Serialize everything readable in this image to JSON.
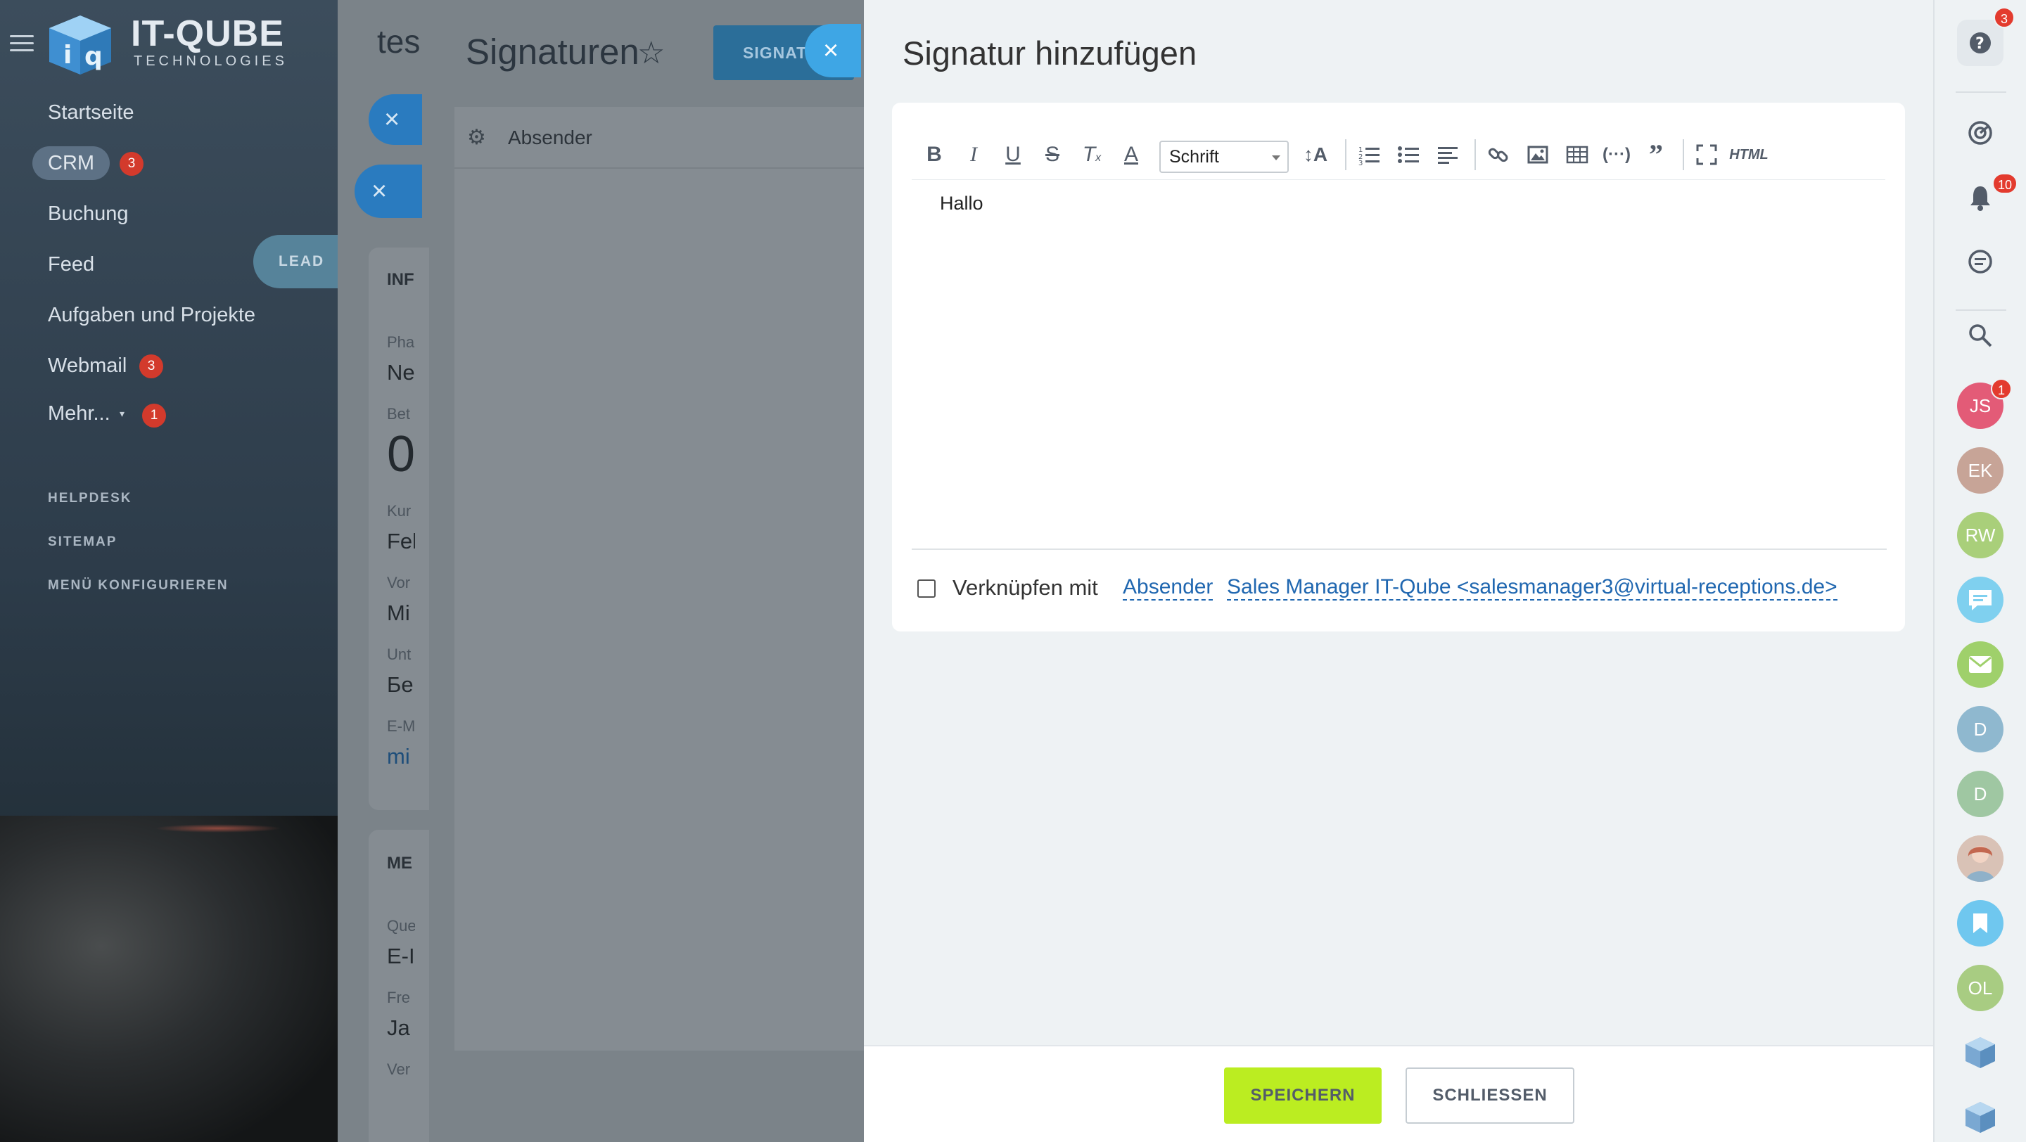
{
  "app": {
    "logo_title": "IT-QUBE",
    "logo_subtitle": "TECHNOLOGIES"
  },
  "left_menu": {
    "items": [
      {
        "label": "Startseite"
      },
      {
        "label": "CRM",
        "badge": "3"
      },
      {
        "label": "Buchung"
      },
      {
        "label": "Feed"
      },
      {
        "label": "Aufgaben und Projekte"
      },
      {
        "label": "Webmail",
        "badge": "3"
      },
      {
        "label": "Mehr...",
        "badge": "1"
      }
    ],
    "sub_items": [
      {
        "label": "HELPDESK"
      },
      {
        "label": "SITEMAP"
      },
      {
        "label": "MENÜ KONFIGURIEREN"
      }
    ],
    "lead_label": "LEAD"
  },
  "crm_behind": {
    "title": "tes",
    "card_section": "INF",
    "fields": [
      {
        "label": "Pha",
        "value": "Ne"
      },
      {
        "label": "Bet",
        "value": "0"
      },
      {
        "label": "Kur",
        "value": "Fel"
      },
      {
        "label": "Vor",
        "value": "Mi"
      },
      {
        "label": "Unt",
        "value": "Бе"
      },
      {
        "label": "E-M",
        "value": "mi"
      }
    ],
    "card2_section": "ME",
    "fields2": [
      {
        "label": "Que",
        "value": "E-I"
      },
      {
        "label": "Fre",
        "value": "Ja"
      },
      {
        "label": "Ver",
        "value": ""
      }
    ]
  },
  "signatures_panel": {
    "title": "Signaturen",
    "button_label": "SIGNATUR",
    "filter_label": "Absender"
  },
  "slider": {
    "title": "Signatur hinzufügen",
    "toolbar": {
      "font_select_value": "Schrift",
      "html_label": "HTML"
    },
    "editor_content": "Hallo",
    "link": {
      "label": "Verknüpfen mit",
      "sender_link": "Absender",
      "sender_value": "Sales Manager IT-Qube <salesmanager3@virtual-receptions.de>",
      "checked": false
    },
    "footer": {
      "save_label": "SPEICHERN",
      "close_label": "SCHLIESSEN"
    }
  },
  "right_bar": {
    "help_badge": "3",
    "notifications_badge": "10",
    "contacts": [
      {
        "initials": "JS",
        "color": "#e35b77",
        "badge": "1"
      },
      {
        "initials": "EK",
        "color": "#c7a497"
      },
      {
        "initials": "RW",
        "color": "#a9cf7a"
      },
      {
        "initials": "",
        "color": "#7fd0ef",
        "icon": "chat-bubble-icon"
      },
      {
        "initials": "",
        "color": "#9fd06b",
        "icon": "mail-icon"
      },
      {
        "initials": "D",
        "color": "#8fb8cf"
      },
      {
        "initials": "D",
        "color": "#9fc7a2"
      },
      {
        "initials": "",
        "color": "#d7b6a6",
        "icon": "user-photo"
      },
      {
        "initials": "",
        "color": "#6fc7ef",
        "icon": "bookmark-icon"
      },
      {
        "initials": "OL",
        "color": "#a8cc82"
      }
    ]
  },
  "colors": {
    "accent_blue": "#3ea6e5",
    "save_green": "#bbed21",
    "badge_red": "#d33a2c"
  }
}
